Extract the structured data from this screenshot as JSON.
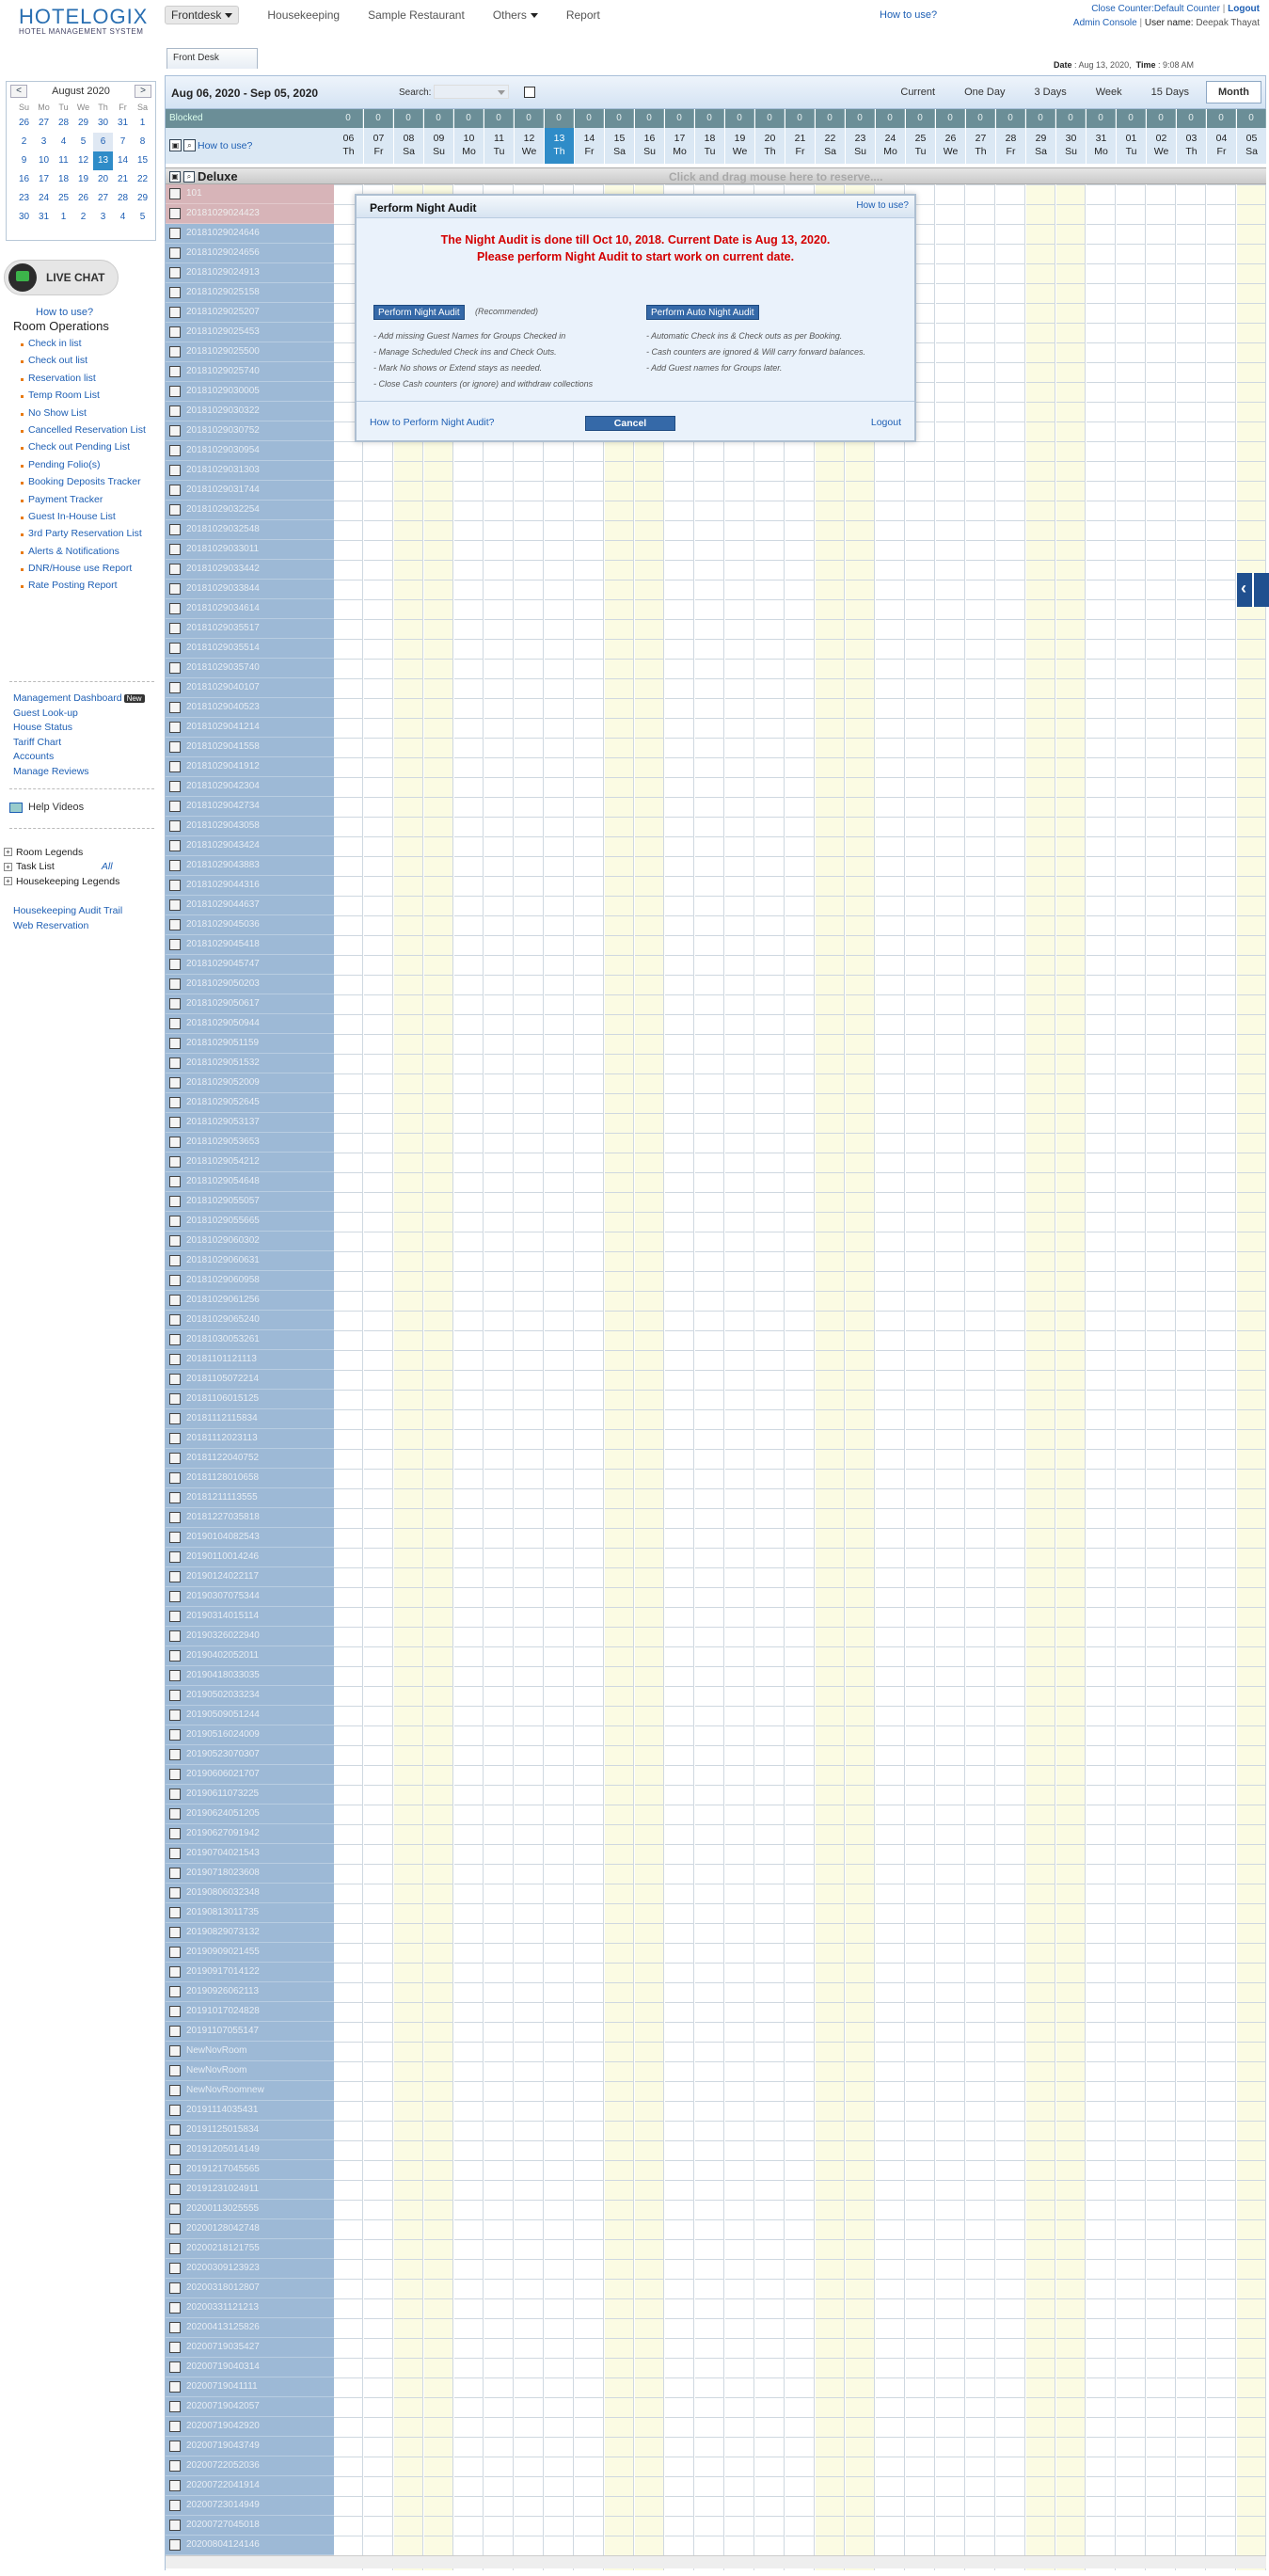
{
  "header": {
    "logo_main": "HOTELOGIX",
    "logo_sub": "HOTEL MANAGEMENT SYSTEM",
    "nav": [
      "Frontdesk",
      "Housekeeping",
      "Sample Restaurant",
      "Others",
      "Report"
    ],
    "howto": "How to use?",
    "close_counter": "Close Counter:Default Counter",
    "logout": "Logout",
    "admin_console": "Admin Console",
    "user_label": "User name:",
    "user_name": "Deepak Thayat",
    "date_label": "Date",
    "date_value": "Aug 13, 2020,",
    "time_label": "Time",
    "time_value": "9:08 AM"
  },
  "calendar": {
    "month": "August 2020",
    "prev": "<",
    "next": ">",
    "dow": [
      "Su",
      "Mo",
      "Tu",
      "We",
      "Th",
      "Fr",
      "Sa"
    ],
    "weeks": [
      [
        "26",
        "27",
        "28",
        "29",
        "30",
        "31",
        "1"
      ],
      [
        "2",
        "3",
        "4",
        "5",
        "6",
        "7",
        "8"
      ],
      [
        "9",
        "10",
        "11",
        "12",
        "13",
        "14",
        "15"
      ],
      [
        "16",
        "17",
        "18",
        "19",
        "20",
        "21",
        "22"
      ],
      [
        "23",
        "24",
        "25",
        "26",
        "27",
        "28",
        "29"
      ],
      [
        "30",
        "31",
        "1",
        "2",
        "3",
        "4",
        "5"
      ]
    ],
    "highlight": "6",
    "today": "13"
  },
  "sidebar": {
    "live_chat": "LIVE CHAT",
    "howto": "How to use?",
    "room_ops_title": "Room Operations",
    "room_ops": [
      "Check in list",
      "Check out list",
      "Reservation list",
      "Temp Room List",
      "No Show List",
      "Cancelled Reservation List",
      "Check out Pending List",
      "Pending Folio(s)",
      "Booking Deposits Tracker",
      "Payment Tracker",
      "Guest In-House List",
      "3rd Party Reservation List",
      "Alerts & Notifications",
      "DNR/House use Report",
      "Rate Posting Report"
    ],
    "management": [
      "Management Dashboard",
      "Guest Look-up",
      "House Status",
      "Tariff Chart",
      "Accounts",
      "Manage Reviews"
    ],
    "new_badge": "New",
    "help_videos": "Help Videos",
    "legends": [
      "Room Legends",
      "Task List",
      "Housekeeping Legends"
    ],
    "task_all": "All",
    "bottom": [
      "Housekeeping Audit Trail",
      "Web Reservation"
    ]
  },
  "main": {
    "tab": "Front Desk",
    "range": "Aug 06, 2020 - Sep 05, 2020",
    "search_label": "Search:",
    "views": [
      "Current",
      "One Day",
      "3 Days",
      "Week",
      "15 Days",
      "Month"
    ],
    "active_view": "Month",
    "blocked": "Blocked",
    "howto": "How to use?",
    "category": "Deluxe",
    "reserve_hint": "Click and drag mouse here to reserve....",
    "days": [
      {
        "d": "06",
        "w": "Th"
      },
      {
        "d": "07",
        "w": "Fr"
      },
      {
        "d": "08",
        "w": "Sa"
      },
      {
        "d": "09",
        "w": "Su"
      },
      {
        "d": "10",
        "w": "Mo"
      },
      {
        "d": "11",
        "w": "Tu"
      },
      {
        "d": "12",
        "w": "We"
      },
      {
        "d": "13",
        "w": "Th"
      },
      {
        "d": "14",
        "w": "Fr"
      },
      {
        "d": "15",
        "w": "Sa"
      },
      {
        "d": "16",
        "w": "Su"
      },
      {
        "d": "17",
        "w": "Mo"
      },
      {
        "d": "18",
        "w": "Tu"
      },
      {
        "d": "19",
        "w": "We"
      },
      {
        "d": "20",
        "w": "Th"
      },
      {
        "d": "21",
        "w": "Fr"
      },
      {
        "d": "22",
        "w": "Sa"
      },
      {
        "d": "23",
        "w": "Su"
      },
      {
        "d": "24",
        "w": "Mo"
      },
      {
        "d": "25",
        "w": "Tu"
      },
      {
        "d": "26",
        "w": "We"
      },
      {
        "d": "27",
        "w": "Th"
      },
      {
        "d": "28",
        "w": "Fr"
      },
      {
        "d": "29",
        "w": "Sa"
      },
      {
        "d": "30",
        "w": "Su"
      },
      {
        "d": "31",
        "w": "Mo"
      },
      {
        "d": "01",
        "w": "Tu"
      },
      {
        "d": "02",
        "w": "We"
      },
      {
        "d": "03",
        "w": "Th"
      },
      {
        "d": "04",
        "w": "Fr"
      },
      {
        "d": "05",
        "w": "Sa"
      }
    ],
    "blocked_count": "0",
    "today_day": "13",
    "rooms": [
      "101",
      "20181029024423",
      "20181029024646",
      "20181029024656",
      "20181029024913",
      "20181029025158",
      "20181029025207",
      "20181029025453",
      "20181029025500",
      "20181029025740",
      "20181029030005",
      "20181029030322",
      "20181029030752",
      "20181029030954",
      "20181029031303",
      "20181029031744",
      "20181029032254",
      "20181029032548",
      "20181029033011",
      "20181029033442",
      "20181029033844",
      "20181029034614",
      "20181029035517",
      "20181029035514",
      "20181029035740",
      "20181029040107",
      "20181029040523",
      "20181029041214",
      "20181029041558",
      "20181029041912",
      "20181029042304",
      "20181029042734",
      "20181029043058",
      "20181029043424",
      "20181029043883",
      "20181029044316",
      "20181029044637",
      "20181029045036",
      "20181029045418",
      "20181029045747",
      "20181029050203",
      "20181029050617",
      "20181029050944",
      "20181029051159",
      "20181029051532",
      "20181029052009",
      "20181029052645",
      "20181029053137",
      "20181029053653",
      "20181029054212",
      "20181029054648",
      "20181029055057",
      "20181029055665",
      "20181029060302",
      "20181029060631",
      "20181029060958",
      "20181029061256",
      "20181029065240",
      "20181030053261",
      "20181101121113",
      "20181105072214",
      "20181106015125",
      "20181112115834",
      "20181112023113",
      "20181122040752",
      "20181128010658",
      "20181211113555",
      "20181227035818",
      "20190104082543",
      "20190110014246",
      "20190124022117",
      "20190307075344",
      "20190314015114",
      "20190326022940",
      "20190402052011",
      "20190418033035",
      "20190502033234",
      "20190509051244",
      "20190516024009",
      "20190523070307",
      "20190606021707",
      "20190611073225",
      "20190624051205",
      "20190627091942",
      "20190704021543",
      "20190718023608",
      "20190806032348",
      "20190813011735",
      "20190829073132",
      "20190909021455",
      "20190917014122",
      "20190926062113",
      "20191017024828",
      "20191107055147",
      "NewNovRoom",
      "NewNovRoom",
      "NewNovRoomnew",
      "20191114035431",
      "20191125015834",
      "20191205014149",
      "20191217045565",
      "20191231024911",
      "20200113025555",
      "20200128042748",
      "20200218121755",
      "20200309123923",
      "20200318012807",
      "20200331121213",
      "20200413125826",
      "20200719035427",
      "20200719040314",
      "20200719041111",
      "20200719042057",
      "20200719042920",
      "20200719043749",
      "20200722052036",
      "20200722041914",
      "20200723014949",
      "20200727045018",
      "20200804124146"
    ]
  },
  "modal": {
    "title": "Perform Night Audit",
    "howto": "How to use?",
    "msg1": "The Night Audit is done till Oct 10, 2018. Current Date is Aug 13, 2020.",
    "msg2": "Please perform Night Audit to start work on current date.",
    "btn_manual": "Perform Night Audit",
    "recommended": "(Recommended)",
    "manual_features": [
      "- Add missing Guest Names for Groups Checked in",
      "- Manage Scheduled Check ins and Check Outs.",
      "- Mark No shows or Extend stays as needed.",
      "- Close Cash counters (or ignore) and withdraw collections"
    ],
    "btn_auto": "Perform Auto Night Audit",
    "auto_features": [
      "- Automatic Check ins & Check outs as per Booking.",
      "- Cash counters are ignored & Will carry forward balances.",
      "- Add Guest names for Groups later."
    ],
    "howto_link": "How to Perform Night Audit?",
    "cancel": "Cancel",
    "logout": "Logout"
  }
}
